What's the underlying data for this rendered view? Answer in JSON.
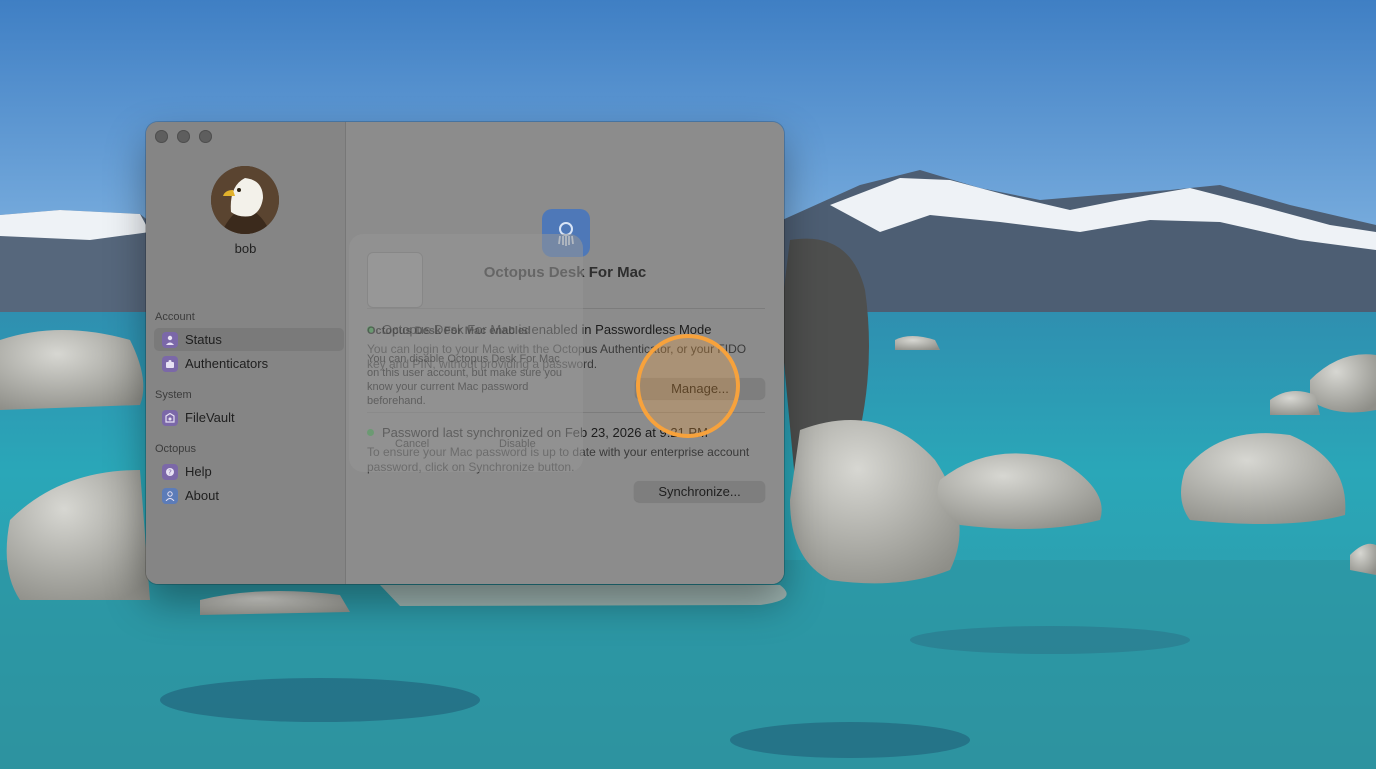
{
  "window": {
    "user": {
      "name": "bob"
    },
    "sidebar": {
      "sections": [
        {
          "header": "Account",
          "items": [
            {
              "label": "Status",
              "icon": "person-icon",
              "selected": true
            },
            {
              "label": "Authenticators",
              "icon": "puzzle-icon",
              "selected": false
            }
          ]
        },
        {
          "header": "System",
          "items": [
            {
              "label": "FileVault",
              "icon": "vault-icon",
              "selected": false
            }
          ]
        },
        {
          "header": "Octopus",
          "items": [
            {
              "label": "Help",
              "icon": "question-icon",
              "selected": false
            },
            {
              "label": "About",
              "icon": "person-icon",
              "selected": false
            }
          ]
        }
      ]
    },
    "content": {
      "app_title": "Octopus Desk For Mac",
      "passwordless": {
        "status": "Octopus Desk For Mac is enabled in Passwordless Mode",
        "description": "You can login to your Mac with the Octopus Authenticator, or your FIDO key and PIN, without providing a password.",
        "button": "Manage..."
      },
      "sync": {
        "status": "Password last synchronized on Feb 23, 2026 at 9:21 PM",
        "description": "To ensure your Mac password is up to date with your enterprise account password, click on Synchronize button.",
        "button": "Synchronize..."
      }
    }
  },
  "ghost_dialog": {
    "title": "Octopus Desk For Mac enabled",
    "text": "You can disable Octopus Desk For Mac on this user account, but make sure you know your current Mac password beforehand.",
    "cancel": "Cancel",
    "disable": "Disable"
  },
  "colors": {
    "status_dot": "#3aa14a",
    "highlight": "#f7a23c",
    "nav_icon": "#7b68a8",
    "app_icon": "#4e78b8"
  }
}
